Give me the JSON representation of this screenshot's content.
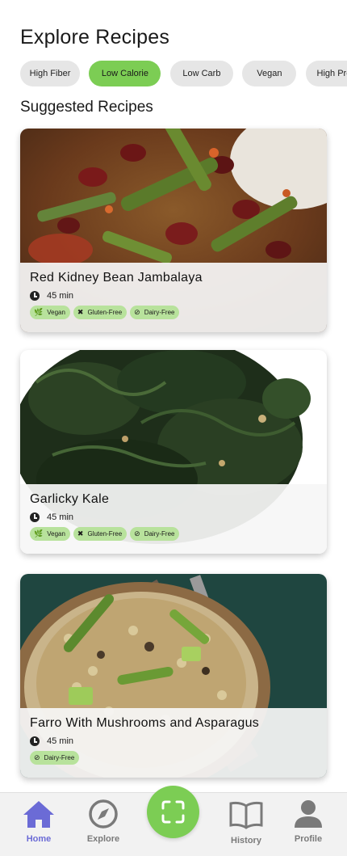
{
  "header": {
    "title": "Explore Recipes"
  },
  "filters": {
    "chips": [
      {
        "label": "High Fiber",
        "active": false
      },
      {
        "label": "Low Calorie",
        "active": true
      },
      {
        "label": "Low Carb",
        "active": false
      },
      {
        "label": "Vegan",
        "active": false
      },
      {
        "label": "High Protein",
        "active": false
      }
    ]
  },
  "suggested": {
    "title": "Suggested Recipes",
    "recipes": [
      {
        "name": "Red Kidney Bean Jambalaya",
        "time": "45 min",
        "tags": [
          {
            "label": "Vegan",
            "icon": "leaf-icon"
          },
          {
            "label": "Gluten-Free",
            "icon": "no-wheat-icon"
          },
          {
            "label": "Dairy-Free",
            "icon": "no-dairy-icon"
          }
        ]
      },
      {
        "name": "Garlicky Kale",
        "time": "45 min",
        "tags": [
          {
            "label": "Vegan",
            "icon": "leaf-icon"
          },
          {
            "label": "Gluten-Free",
            "icon": "no-wheat-icon"
          },
          {
            "label": "Dairy-Free",
            "icon": "no-dairy-icon"
          }
        ]
      },
      {
        "name": "Farro With Mushrooms and Asparagus",
        "time": "45 min",
        "tags": [
          {
            "label": "Dairy-Free",
            "icon": "no-dairy-icon"
          }
        ]
      }
    ]
  },
  "navbar": {
    "items": [
      {
        "label": "Home",
        "icon": "home-icon",
        "active": true
      },
      {
        "label": "Explore",
        "icon": "compass-icon",
        "active": false
      },
      {
        "label": "",
        "icon": "scan-icon",
        "active": false
      },
      {
        "label": "History",
        "icon": "book-icon",
        "active": false
      },
      {
        "label": "Profile",
        "icon": "person-icon",
        "active": false
      }
    ]
  },
  "colors": {
    "accent": "#7ccd54",
    "tag": "#b8e29c",
    "nav_active": "#6b6bd6",
    "chip": "#e6e6e6"
  }
}
